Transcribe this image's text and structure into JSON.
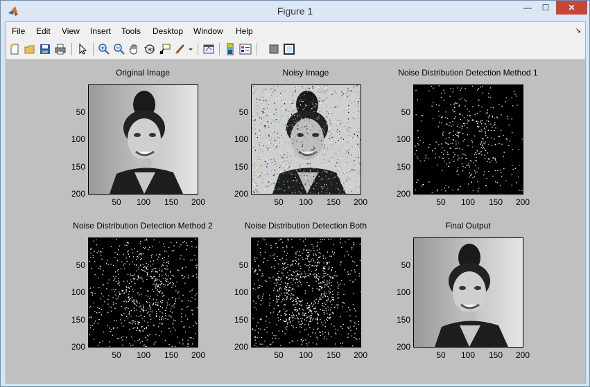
{
  "window": {
    "title": "Figure 1",
    "minimize_glyph": "—",
    "maximize_glyph": "☐",
    "close_glyph": "✕",
    "app_icon": "matlab-logo-icon"
  },
  "menubar": {
    "items": [
      "File",
      "Edit",
      "View",
      "Insert",
      "Tools",
      "Desktop",
      "Window",
      "Help"
    ],
    "dock_glyph": "↘"
  },
  "toolbar": {
    "icons": [
      "new-figure-icon",
      "open-file-icon",
      "save-icon",
      "print-icon",
      "select-arrow-icon",
      "zoom-in-icon",
      "zoom-out-icon",
      "pan-hand-icon",
      "rotate-3d-icon",
      "data-cursor-icon",
      "brush-icon",
      "brush-dropdown-icon",
      "link-plot-icon",
      "colorbar-icon",
      "legend-icon",
      "hide-plot-tools-icon",
      "show-plot-tools-icon"
    ]
  },
  "figure": {
    "background": "#c0c0c0",
    "panels": [
      {
        "title": "Original Image",
        "image_type": "grayscale-portrait",
        "yticks": [
          "50",
          "100",
          "150",
          "200"
        ],
        "xticks": [
          "50",
          "100",
          "150",
          "200"
        ]
      },
      {
        "title": "Noisy Image",
        "image_type": "noisy-portrait",
        "yticks": [
          "50",
          "100",
          "150",
          "200"
        ],
        "xticks": [
          "50",
          "100",
          "150",
          "200"
        ]
      },
      {
        "title": "Noise Distribution Detection Method 1",
        "image_type": "noise-map",
        "yticks": [
          "50",
          "100",
          "150",
          "200"
        ],
        "xticks": [
          "50",
          "100",
          "150",
          "200"
        ]
      },
      {
        "title": "Noise Distribution Detection Method 2",
        "image_type": "noise-map",
        "yticks": [
          "50",
          "100",
          "150",
          "200"
        ],
        "xticks": [
          "50",
          "100",
          "150",
          "200"
        ]
      },
      {
        "title": "Noise Distribution Detection Both",
        "image_type": "noise-map",
        "yticks": [
          "50",
          "100",
          "150",
          "200"
        ],
        "xticks": [
          "50",
          "100",
          "150",
          "200"
        ]
      },
      {
        "title": "Final Output",
        "image_type": "grayscale-portrait",
        "yticks": [
          "50",
          "100",
          "150",
          "200"
        ],
        "xticks": [
          "50",
          "100",
          "150",
          "200"
        ]
      }
    ]
  }
}
